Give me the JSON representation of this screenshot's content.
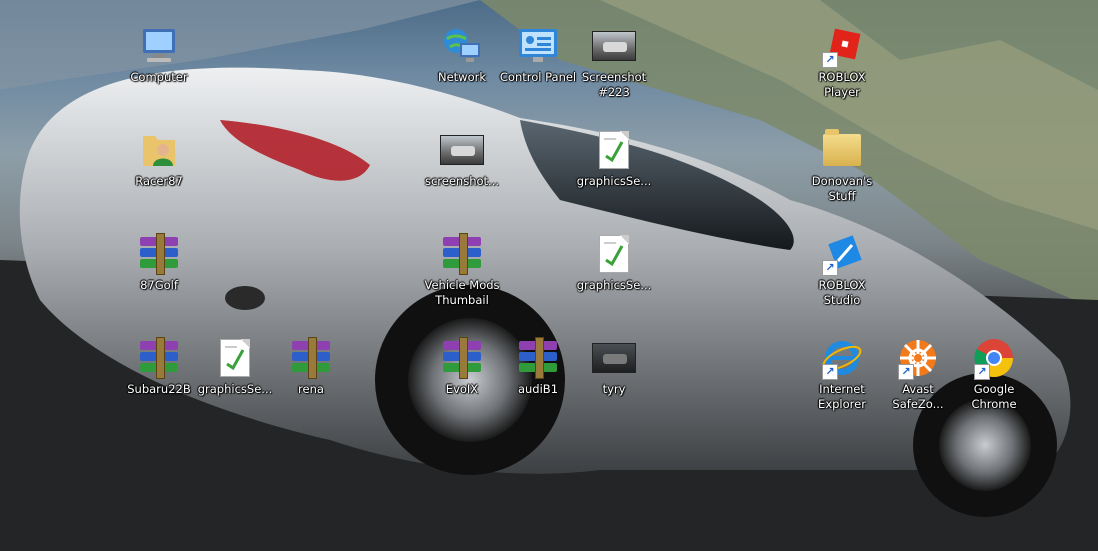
{
  "desktop": {
    "icons": [
      {
        "label": "Computer",
        "icon": "computer-icon",
        "shortcut": false
      },
      {
        "label": "Network",
        "icon": "network-icon",
        "shortcut": false
      },
      {
        "label": "Control Panel",
        "icon": "control-panel-icon",
        "shortcut": false
      },
      {
        "label": "Screenshot #223",
        "icon": "image-thumbnail-icon",
        "shortcut": false
      },
      {
        "label": "ROBLOX Player",
        "icon": "roblox-icon",
        "shortcut": true
      },
      {
        "label": "Racer87",
        "icon": "user-folder-icon",
        "shortcut": false
      },
      {
        "label": "screenshot...",
        "icon": "image-thumbnail-icon",
        "shortcut": false
      },
      {
        "label": "graphicsSe...",
        "icon": "text-document-icon",
        "shortcut": false
      },
      {
        "label": "Donovan's Stuff",
        "icon": "folder-icon",
        "shortcut": false
      },
      {
        "label": "87Golf",
        "icon": "winrar-archive-icon",
        "shortcut": false
      },
      {
        "label": "Vehicle Mods Thumbail",
        "icon": "winrar-archive-icon",
        "shortcut": false
      },
      {
        "label": "graphicsSe...",
        "icon": "text-document-icon",
        "shortcut": false
      },
      {
        "label": "ROBLOX Studio",
        "icon": "roblox-studio-icon",
        "shortcut": true
      },
      {
        "label": "Subaru22B",
        "icon": "winrar-archive-icon",
        "shortcut": false
      },
      {
        "label": "graphicsSe...",
        "icon": "text-document-icon",
        "shortcut": false
      },
      {
        "label": "rena",
        "icon": "winrar-archive-icon",
        "shortcut": false
      },
      {
        "label": "EvoIX",
        "icon": "winrar-archive-icon",
        "shortcut": false
      },
      {
        "label": "audiB1",
        "icon": "winrar-archive-icon",
        "shortcut": false
      },
      {
        "label": "tyry",
        "icon": "image-thumbnail-icon",
        "shortcut": false
      },
      {
        "label": "Internet Explorer",
        "icon": "internet-explorer-icon",
        "shortcut": true
      },
      {
        "label": "Avast SafeZo...",
        "icon": "avast-icon",
        "shortcut": true
      },
      {
        "label": "Google Chrome",
        "icon": "chrome-icon",
        "shortcut": true
      }
    ]
  }
}
